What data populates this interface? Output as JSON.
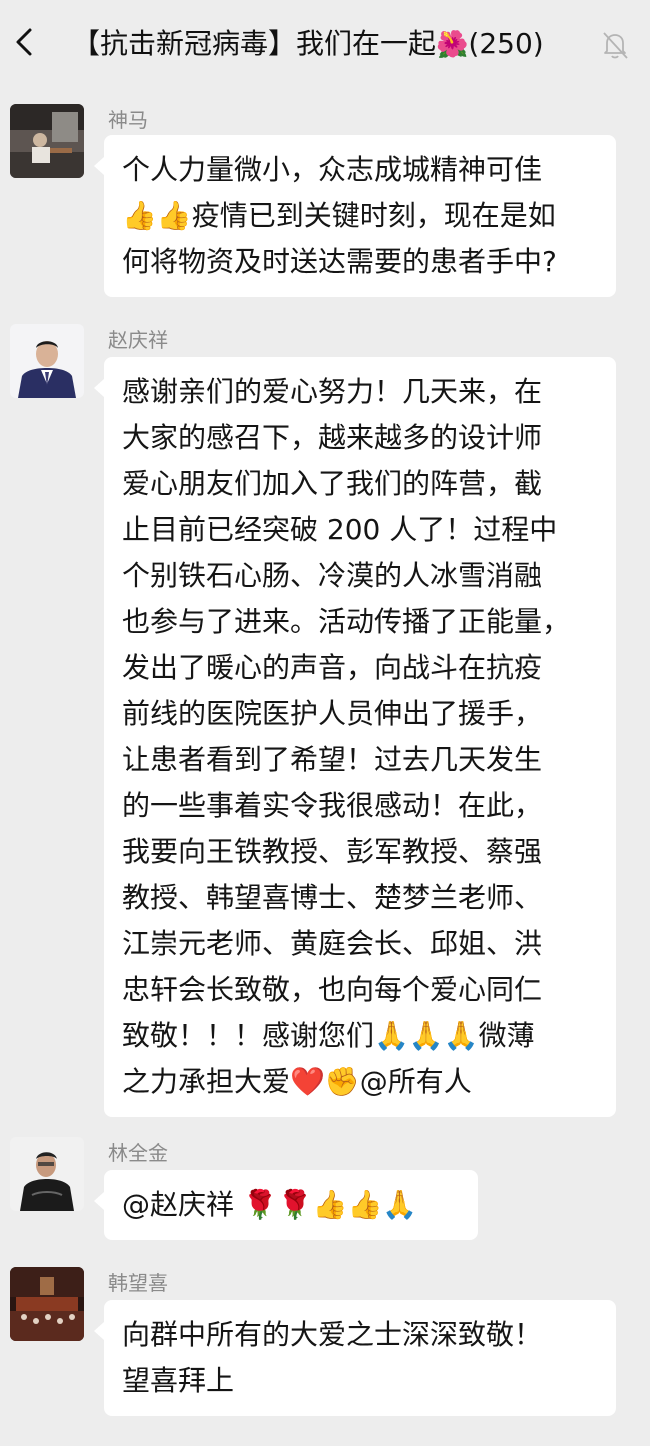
{
  "header": {
    "back_icon": "chevron-left-icon",
    "title_text": "【抗击新冠病毒】我们在一起",
    "title_emoji": "🌺",
    "member_count": "(250)",
    "mute_icon": "bell-off-icon"
  },
  "messages": [
    {
      "sender": "神马",
      "lines": [
        "个人力量微小，众志成城精神可佳",
        "👍👍疫情已到关键时刻，现在是如",
        "何将物资及时送达需要的患者手中?"
      ]
    },
    {
      "sender": "赵庆祥",
      "lines": [
        "感谢亲们的爱心努力！几天来，在",
        "大家的感召下，越来越多的设计师",
        "爱心朋友们加入了我们的阵营，截",
        "止目前已经突破 200 人了！过程中",
        "个别铁石心肠、冷漠的人冰雪消融",
        "也参与了进来。活动传播了正能量，",
        "发出了暖心的声音，向战斗在抗疫",
        "前线的医院医护人员伸出了援手，",
        "让患者看到了希望！过去几天发生",
        "的一些事着实令我很感动！在此，",
        "我要向王铁教授、彭军教授、蔡强",
        "教授、韩望喜博士、楚梦兰老师、",
        "江崇元老师、黄庭会长、邱姐、洪",
        "忠轩会长致敬，也向每个爱心同仁",
        "致敬！！！感谢您们🙏🙏🙏微薄",
        "之力承担大爱❤️✊@所有人"
      ]
    },
    {
      "sender": "林全金",
      "lines": [
        "@赵庆祥 🌹🌹👍👍🙏"
      ]
    },
    {
      "sender": "韩望喜",
      "lines": [
        "向群中所有的大爱之士深深致敬！",
        "望喜拜上"
      ]
    }
  ]
}
